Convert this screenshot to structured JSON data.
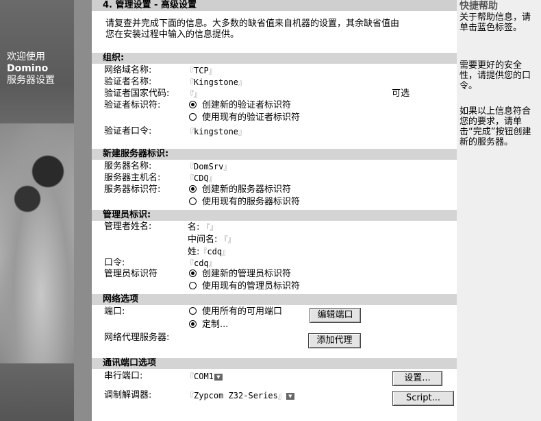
{
  "sidebar": {
    "welcome_line1": "欢迎使用",
    "welcome_line2": "Domino",
    "welcome_line3": "服务器设置"
  },
  "title": "4. 管理设置 - 高级设置",
  "intro_line1": "请复查并完成下面的信息。大多数的缺省值来自机器的设置，其余缺省值由",
  "intro_line2": "您在安装过程中输入的信息提供。",
  "org": {
    "header": "组织:",
    "domain_label": "网络域名称:",
    "domain_value": "TCP",
    "certifier_label": "验证者名称:",
    "certifier_value": "Kingstone",
    "country_label": "验证者国家代码:",
    "country_value": "",
    "country_optional": "可选",
    "id_label": "验证者标识符:",
    "id_opt_new": "创建新的验证者标识符",
    "id_opt_existing": "使用现有的验证者标识符",
    "password_label": "验证者口令:",
    "password_value": "kingstone"
  },
  "server": {
    "header": "新建服务器标识:",
    "name_label": "服务器名称:",
    "name_value": "DomSrv",
    "host_label": "服务器主机名:",
    "host_value": "CDQ",
    "id_label": "服务器标识符:",
    "id_opt_new": "创建新的服务器标识符",
    "id_opt_existing": "使用现有的服务器标识符"
  },
  "admin": {
    "header": "管理员标识:",
    "name_label": "管理者姓名:",
    "first_label": "名:",
    "first_value": "",
    "middle_label": "中间名:",
    "middle_value": "",
    "last_label": "姓:",
    "last_value": "cdq",
    "password_label": "口令:",
    "password_value": "cdq",
    "id_label": "管理员标识符",
    "id_opt_new": "创建新的管理员标识符",
    "id_opt_existing": "使用现有的管理员标识符"
  },
  "network": {
    "header": "网络选项",
    "port_label": "端口:",
    "port_opt_all": "使用所有的可用端口",
    "port_opt_custom": "定制...",
    "edit_ports": "编辑端口",
    "proxy_label": "网络代理服务器:",
    "add_proxy": "添加代理"
  },
  "comm": {
    "header": "通讯端口选项",
    "serial_label": "串行端口:",
    "serial_value": "COM1",
    "settings_btn": "设置...",
    "modem_label": "调制解调器:",
    "modem_value": "Zypcom Z32-Series",
    "script_btn": "Script..."
  },
  "help": {
    "title": "快捷帮助",
    "p1": "关于帮助信息，请单击蓝色标签。",
    "p2": "需要更好的安全性，请提供您的口令。",
    "p3": "如果以上信息符合您的要求，请单击“完成”按钮创建新的服务器。"
  },
  "brackets": {
    "open": "『",
    "close": "』"
  },
  "colors": {
    "header_bg": "#d4d4d4",
    "help_bg": "#efefef",
    "stripe": "#8c8c8c"
  }
}
